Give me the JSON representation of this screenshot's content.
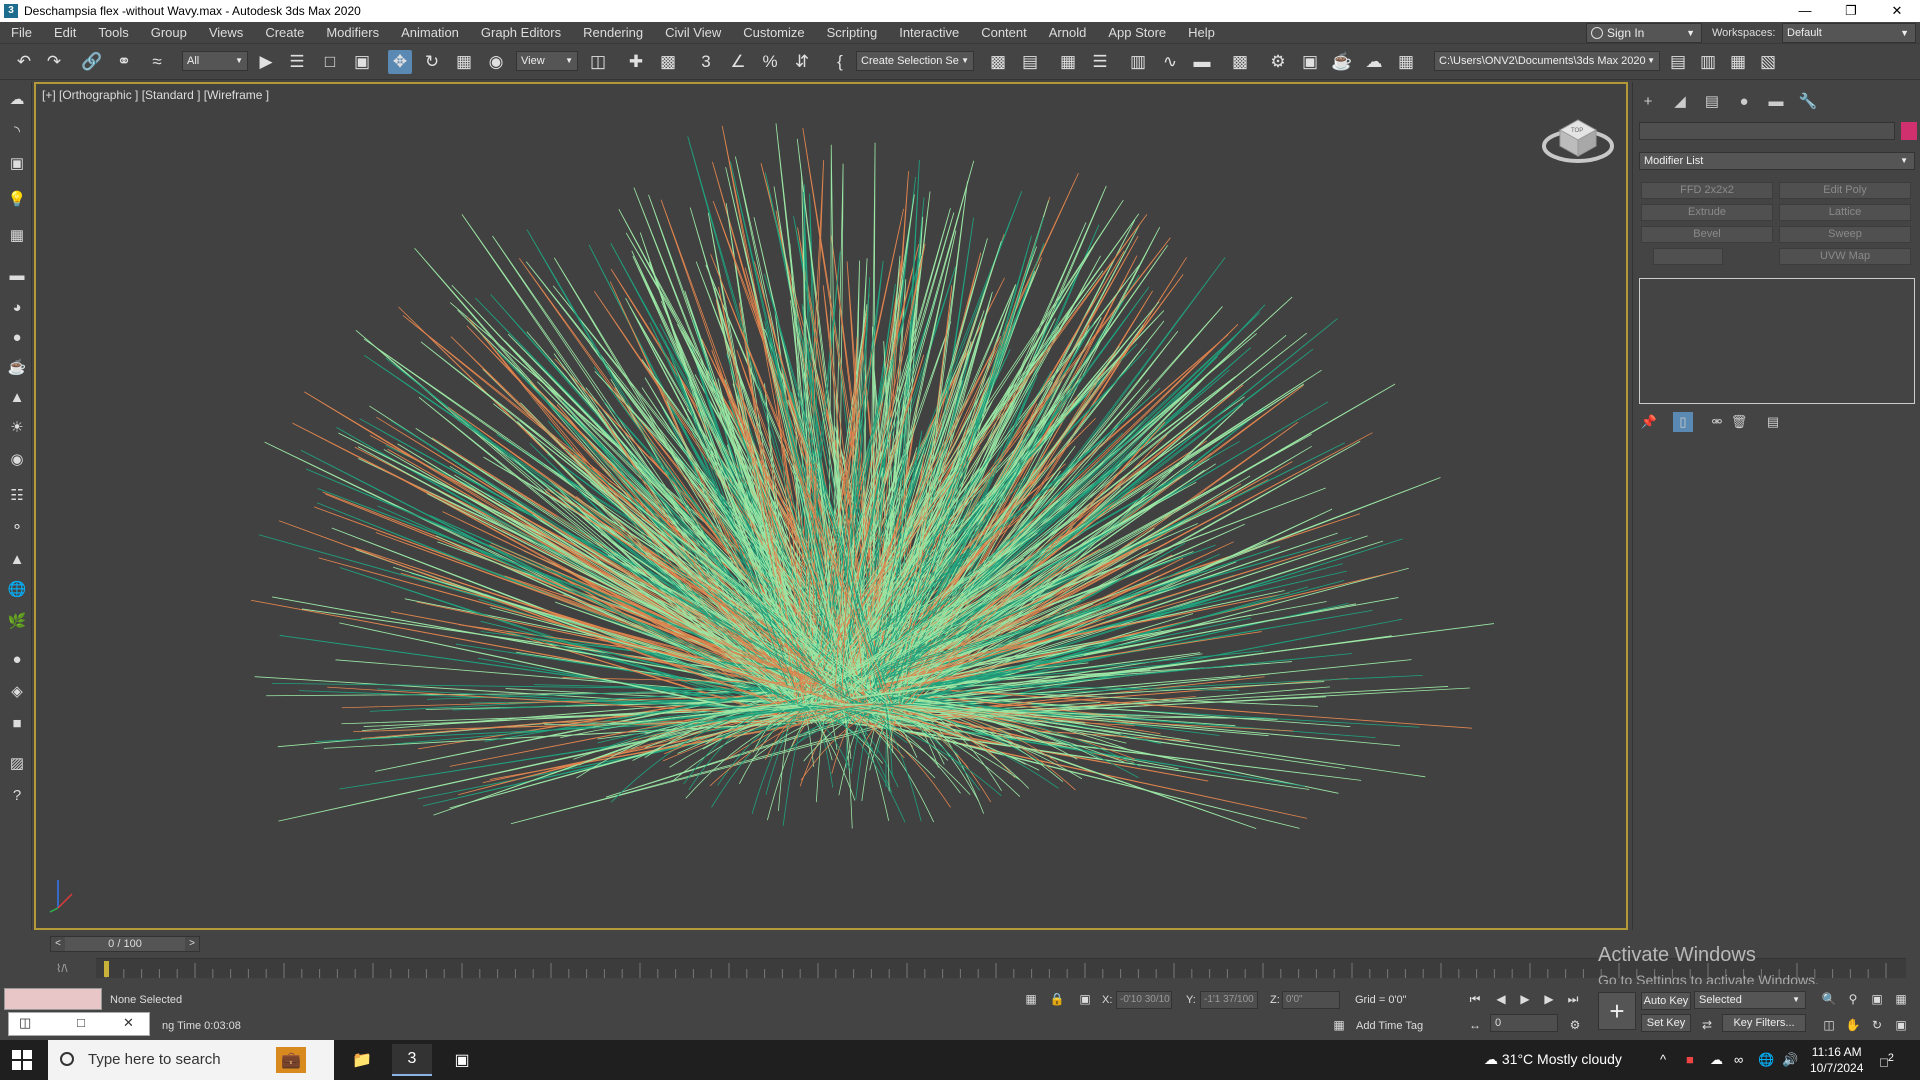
{
  "window": {
    "title": "Deschampsia flex -without Wavy.max - Autodesk 3ds Max 2020",
    "app_icon_label": "3"
  },
  "menu": [
    "File",
    "Edit",
    "Tools",
    "Group",
    "Views",
    "Create",
    "Modifiers",
    "Animation",
    "Graph Editors",
    "Rendering",
    "Civil View",
    "Customize",
    "Scripting",
    "Interactive",
    "Content",
    "Arnold",
    "App Store",
    "Help"
  ],
  "account": {
    "sign_in": "Sign In",
    "workspaces_label": "Workspaces:",
    "workspace": "Default"
  },
  "toolbar": {
    "filter": "All",
    "ref_coord": "View",
    "selection_set": "Create Selection Se",
    "project_path": "C:\\Users\\ONV2\\Documents\\3ds Max 2020"
  },
  "viewport": {
    "label": "[+] [Orthographic ] [Standard ] [Wireframe ]",
    "viewcube_face": "TOP"
  },
  "command_panel": {
    "modifier_list": "Modifier List",
    "object_color": "#d0306e",
    "modifier_buttons": [
      "FFD 2x2x2",
      "Edit Poly",
      "Extrude",
      "Lattice",
      "Bevel",
      "Sweep",
      "",
      "UVW Map"
    ]
  },
  "timeline": {
    "frame_display": "0 / 100",
    "prev": "<",
    "next": ">",
    "track_icon": "⌇/\\"
  },
  "status": {
    "selection": "None Selected",
    "render_time": "ng Time  0:03:08",
    "x_label": "X:",
    "x_value": "-0'10 30/10",
    "y_label": "Y:",
    "y_value": "-1'1 37/100",
    "z_label": "Z:",
    "z_value": "0'0\"",
    "grid": "Grid = 0'0\"",
    "add_time_tag": "Add Time Tag"
  },
  "anim": {
    "auto_key": "Auto Key",
    "set_key": "Set Key",
    "key_mode": "Selected",
    "key_filters": "Key Filters...",
    "frame": "0"
  },
  "watermark": {
    "line1": "Activate Windows",
    "line2": "Go to Settings to activate Windows."
  },
  "taskbar": {
    "search_placeholder": "Type here to search",
    "weather": "31°C  Mostly cloudy",
    "time": "11:16 AM",
    "date": "10/7/2024",
    "notif_count": "2"
  },
  "grass_colors": {
    "light_green": "#9be6a4",
    "teal": "#1fa27e",
    "orange": "#e0844e"
  }
}
